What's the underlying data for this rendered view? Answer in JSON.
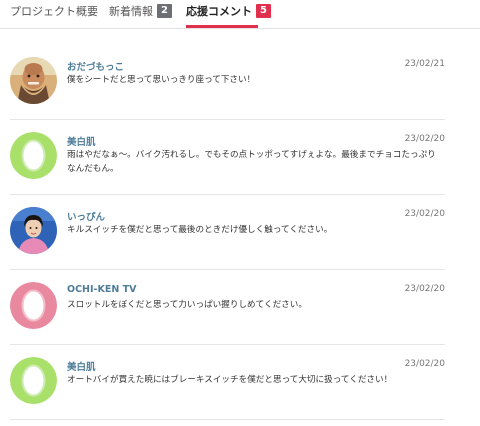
{
  "tabs": [
    {
      "label": "プロジェクト概要"
    },
    {
      "label": "新着情報",
      "badge": "2"
    },
    {
      "label": "応援コメント",
      "badge": "5"
    }
  ],
  "comments": [
    {
      "author": "おだづもっこ",
      "date": "23/02/21",
      "text": "僕をシートだと思って思いっきり座って下さい！",
      "avatar": "photo-man-avatar"
    },
    {
      "author": "美白肌",
      "date": "23/02/20",
      "text": "雨はやだなぁ〜。バイク汚れるし。でもその点トッポってすげぇよな。最後までチョコたっぷりなんだもん。",
      "avatar": "default-avatar-green"
    },
    {
      "author": "いっぴん",
      "date": "23/02/20",
      "text": "キルスイッチを僕だと思って最後のときだけ優しく触ってください。",
      "avatar": "photo-woman-avatar"
    },
    {
      "author": "OCHI-KEN TV",
      "date": "23/02/20",
      "text": "スロットルをぼくだと思って力いっぱい握りしめてください。",
      "avatar": "default-avatar-pink"
    },
    {
      "author": "美白肌",
      "date": "23/02/20",
      "text": "オートバイが買えた暁にはブレーキスイッチを僕だと思って大切に扱ってください！",
      "avatar": "default-avatar-green"
    }
  ],
  "colors": {
    "accent": "#e0304e",
    "author": "#4f7d99",
    "avatar_green": "#a8e06a",
    "avatar_pink": "#e8899f"
  }
}
